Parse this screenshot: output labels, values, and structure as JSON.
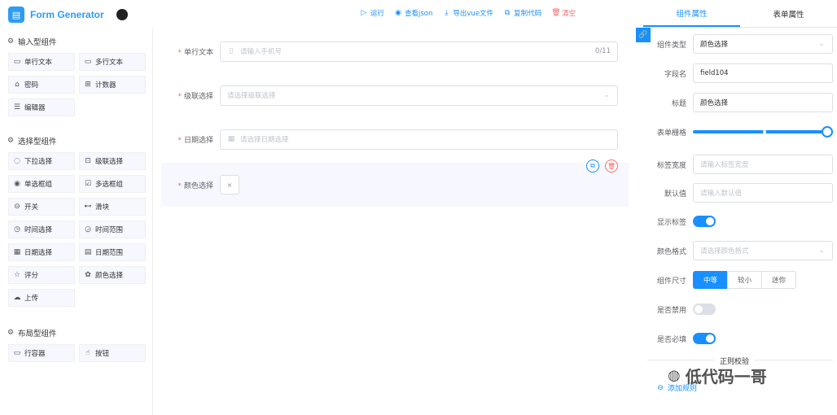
{
  "app": {
    "logo_glyph": "▤",
    "title": "Form Generator",
    "github": "github-icon"
  },
  "toolbar": {
    "run": "运行",
    "view_json": "查看json",
    "export_vue": "导出vue文件",
    "copy_code": "复制代码",
    "clear": "清空"
  },
  "left": {
    "input_section": "输入型组件",
    "input_items": [
      "单行文本",
      "多行文本",
      "密码",
      "计数器",
      "编辑器"
    ],
    "select_section": "选择型组件",
    "select_items": [
      "下拉选择",
      "级联选择",
      "单选框组",
      "多选框组",
      "开关",
      "滑块",
      "时间选择",
      "时间范围",
      "日期选择",
      "日期范围",
      "评分",
      "颜色选择",
      "上传"
    ],
    "layout_section": "布局型组件",
    "layout_items": [
      "行容器",
      "按钮"
    ]
  },
  "form": {
    "fields": [
      {
        "label": "单行文本",
        "placeholder": "请输入手机号",
        "counter": "0/11"
      },
      {
        "label": "级联选择",
        "placeholder": "请选择级联选择"
      },
      {
        "label": "日期选择",
        "placeholder": "请选择日期选择"
      },
      {
        "label": "颜色选择"
      }
    ]
  },
  "panel": {
    "tabs": [
      "组件属性",
      "表单属性"
    ],
    "component_type_label": "组件类型",
    "component_type_value": "颜色选择",
    "field_name_label": "字段名",
    "field_name_value": "field104",
    "title_label": "标题",
    "title_value": "颜色选择",
    "grid_label": "表单栅格",
    "grid_value": 1,
    "label_width_label": "标签宽度",
    "label_width_placeholder": "请输入标签宽度",
    "default_label": "默认值",
    "default_placeholder": "请输入默认值",
    "show_label_label": "显示标签",
    "show_label_on": true,
    "color_format_label": "颜色格式",
    "color_format_placeholder": "请选择颜色格式",
    "size_label": "组件尺寸",
    "sizes": [
      "中等",
      "较小",
      "迷你"
    ],
    "disabled_label": "是否禁用",
    "disabled_on": false,
    "required_label": "是否必填",
    "required_on": true,
    "regex_label": "正则校验",
    "add_rule": "添加规则"
  },
  "watermark": "低代码一哥",
  "colors": {
    "accent": "#1890ff",
    "danger": "#f56c6c"
  }
}
